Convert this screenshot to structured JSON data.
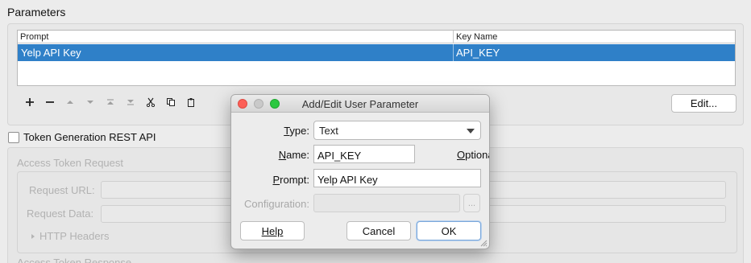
{
  "parameters": {
    "title": "Parameters",
    "columns": [
      "Prompt",
      "Key Name"
    ],
    "rows": [
      {
        "prompt": "Yelp API Key",
        "key_name": "API_KEY"
      }
    ],
    "edit_label": "Edit..."
  },
  "token_generation": {
    "label": "Token Generation REST API",
    "checked": false,
    "access_token_request": "Access Token Request",
    "request_url_label": "Request URL:",
    "request_data_label": "Request Data:",
    "http_headers_label": "HTTP Headers",
    "access_token_response": "Access Token Response"
  },
  "dialog": {
    "title": "Add/Edit User Parameter",
    "type_label": "Type:",
    "type_value": "Text",
    "name_label": "Name:",
    "name_value": "API_KEY",
    "optional_label": "Optional",
    "optional_checked": false,
    "prompt_label": "Prompt:",
    "prompt_value": "Yelp API Key",
    "configuration_label": "Configuration:",
    "configuration_value": "",
    "browse_label": "...",
    "help_label": "Help",
    "cancel_label": "Cancel",
    "ok_label": "OK"
  },
  "colors": {
    "selection": "#2f80c8",
    "close": "#fc5f57",
    "minimize": "#c9c9c9",
    "zoom": "#2bc840"
  }
}
